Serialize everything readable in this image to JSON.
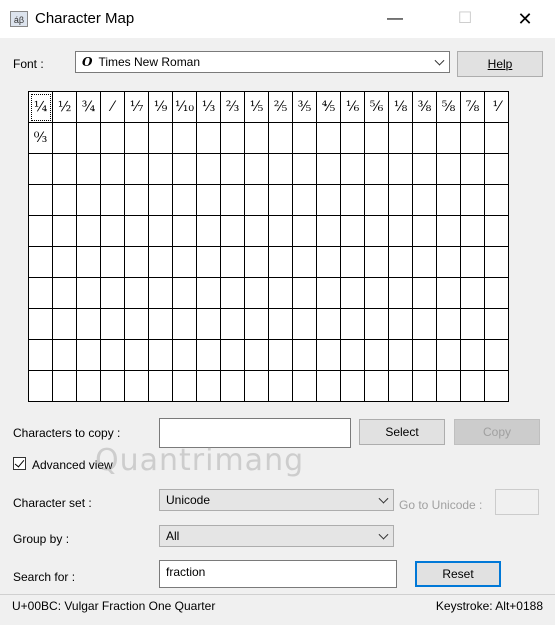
{
  "window": {
    "title": "Character Map",
    "icon": "charmap-app-icon"
  },
  "controls": {
    "minimize": "—",
    "maximize": "☐",
    "close": "✕"
  },
  "font": {
    "label": "Font :",
    "value": "Times New Roman",
    "type_icon": "O",
    "help_button": "Help"
  },
  "grid": {
    "characters": [
      "¼",
      "½",
      "¾",
      "⁄",
      "⅐",
      "⅑",
      "⅒",
      "⅓",
      "⅔",
      "⅕",
      "⅖",
      "⅗",
      "⅘",
      "⅙",
      "⅚",
      "⅛",
      "⅜",
      "⅝",
      "⅞",
      "⅟",
      "↉"
    ],
    "selected_index": 0
  },
  "copy": {
    "label": "Characters to copy :",
    "value": "",
    "select_button": "Select",
    "copy_button": "Copy"
  },
  "advanced": {
    "label": "Advanced view",
    "checked": true
  },
  "charset": {
    "label": "Character set :",
    "value": "Unicode",
    "goto_label": "Go to Unicode :",
    "goto_value": ""
  },
  "groupby": {
    "label": "Group by :",
    "value": "All"
  },
  "search": {
    "label": "Search for :",
    "value": "fraction",
    "reset_button": "Reset"
  },
  "status": {
    "text": "U+00BC: Vulgar Fraction One Quarter",
    "keystroke": "Keystroke: Alt+0188"
  },
  "watermark": "Quantrimang"
}
